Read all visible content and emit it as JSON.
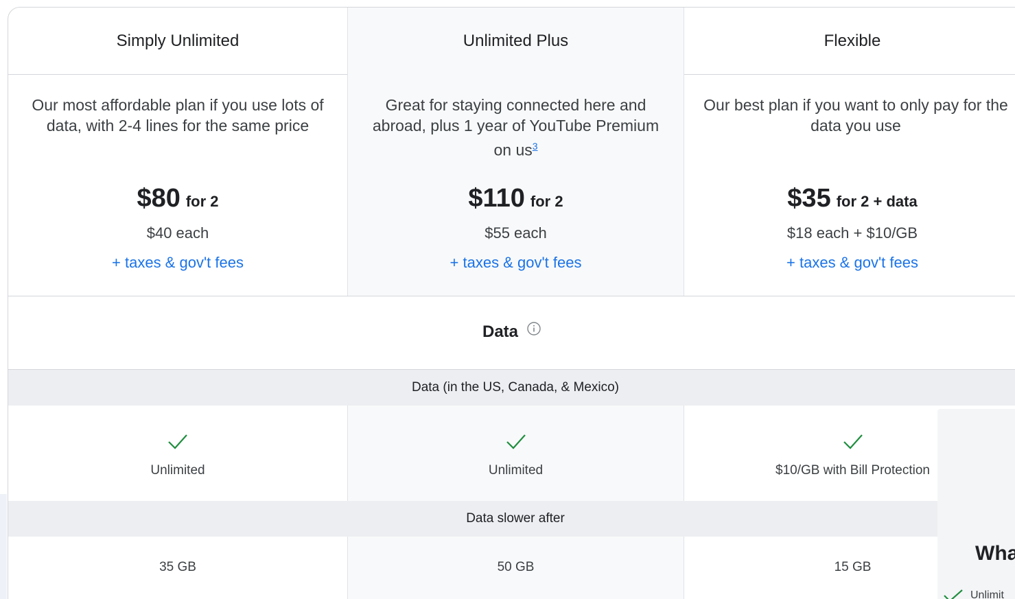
{
  "plans": [
    {
      "name": "Simply Unlimited",
      "description": "Our most affordable plan if you use lots of data, with 2-4 lines for the same price",
      "price": "$80",
      "price_suffix": "for 2",
      "each": "$40 each",
      "fees_link": "+ taxes & gov't fees"
    },
    {
      "name": "Unlimited Plus",
      "description": "Great for staying connected here and abroad, plus 1 year of YouTube Premium on us",
      "footnote": "3",
      "price": "$110",
      "price_suffix": "for 2",
      "each": "$55 each",
      "fees_link": "+ taxes & gov't fees"
    },
    {
      "name": "Flexible",
      "description": "Our best plan if you want to only pay for the data you use",
      "price": "$35",
      "price_suffix": "for 2 + data",
      "each": "$18 each + $10/GB",
      "fees_link": "+ taxes & gov't fees"
    }
  ],
  "section": {
    "title": "Data",
    "info_icon": "info-icon"
  },
  "rows": [
    {
      "label": "Data (in the US, Canada, & Mexico)",
      "values": [
        "Unlimited",
        "Unlimited",
        "$10/GB with Bill Protection"
      ],
      "icons": [
        "check-icon",
        "check-icon",
        "check-icon"
      ]
    },
    {
      "label": "Data slower after",
      "values": [
        "35 GB",
        "50 GB",
        "15 GB"
      ]
    }
  ],
  "overlay": {
    "title": "Wha",
    "item": "Unlimit"
  },
  "colors": {
    "link": "#1a73e8",
    "check": "#1e8e3e",
    "subheader_bg": "#eceef1",
    "highlight_col_bg": "#f8f9fa"
  }
}
